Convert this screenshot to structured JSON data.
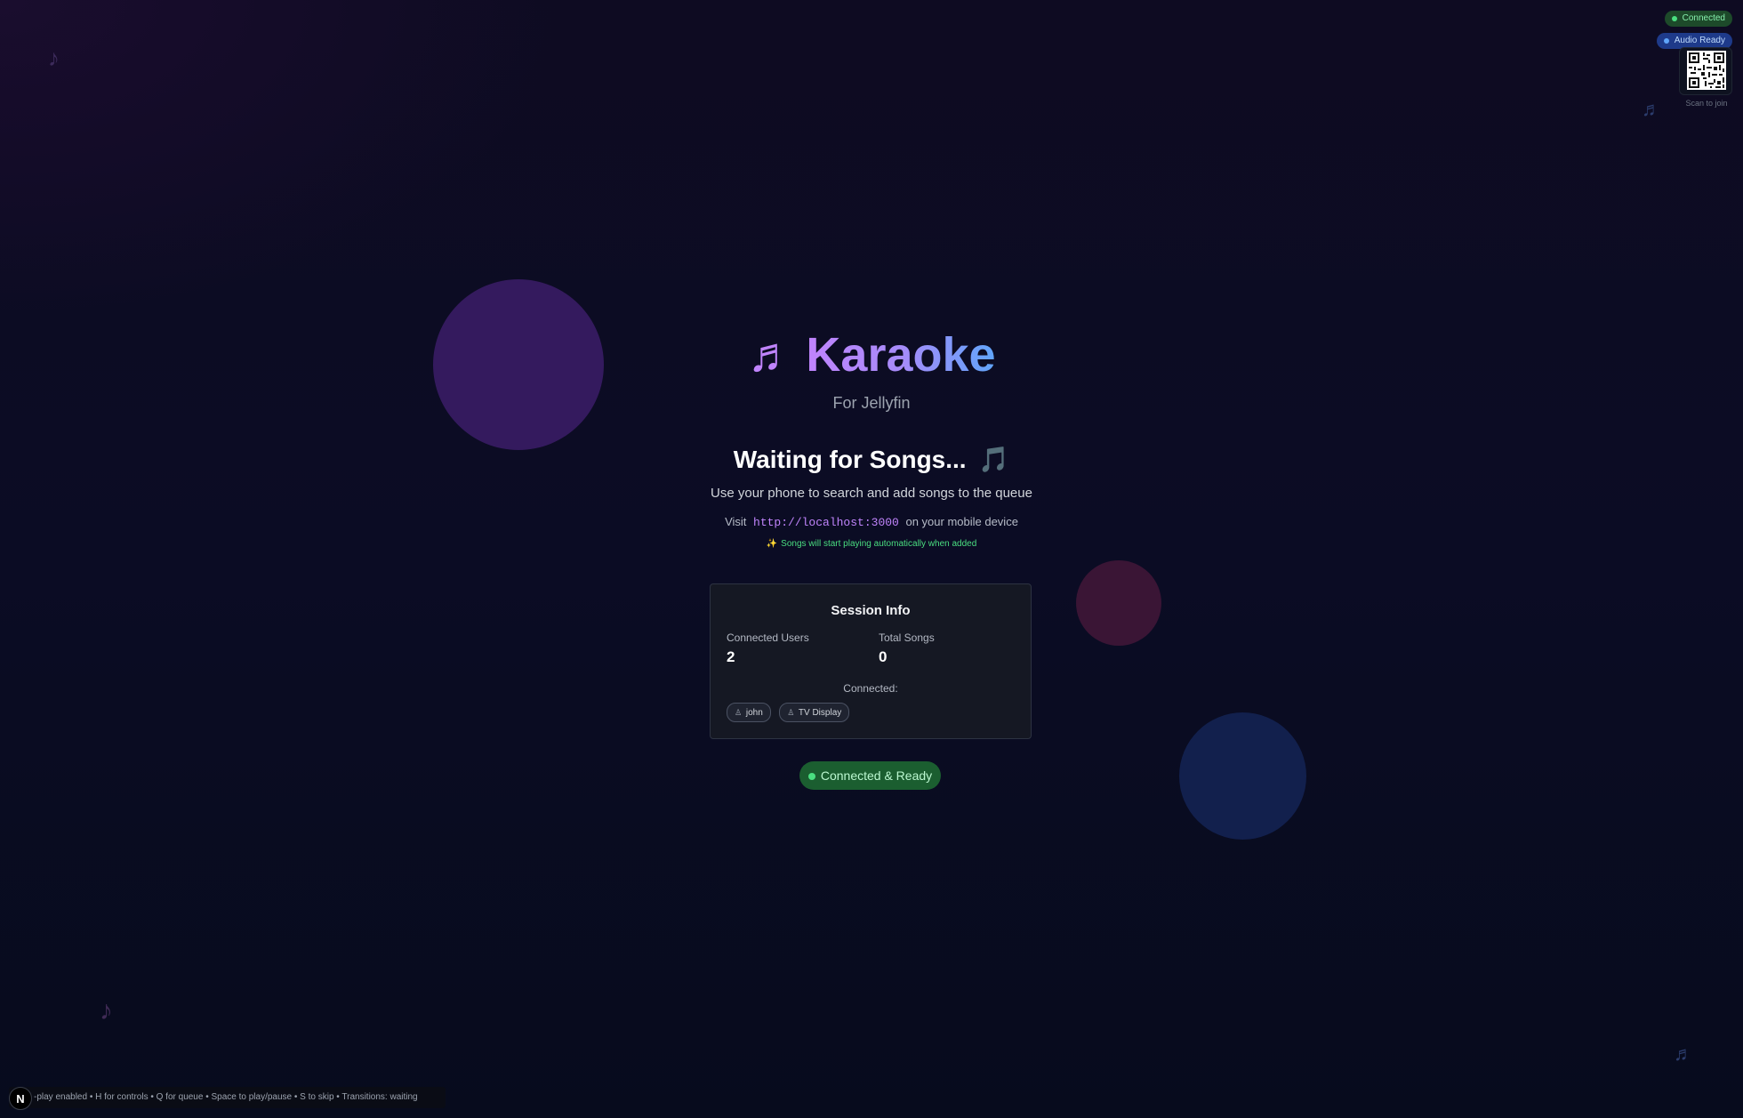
{
  "status": {
    "connection": "Connected",
    "audio": "Audio Ready",
    "qr_caption": "Scan to join"
  },
  "header": {
    "icon": "♬",
    "title": "Karaoke",
    "subtitle": "For Jellyfin"
  },
  "waiting": {
    "heading": "Waiting for Songs...",
    "heading_icon": "🎵",
    "instruction": "Use your phone to search and add songs to the queue",
    "visit_prefix": "Visit",
    "url": "http://localhost:3000",
    "visit_suffix": "on your mobile device",
    "auto_icon": "✨",
    "auto_text": "Songs will start playing automatically when added"
  },
  "session": {
    "title": "Session Info",
    "users_label": "Connected Users",
    "users_value": "2",
    "songs_label": "Total Songs",
    "songs_value": "0",
    "connected_label": "Connected:",
    "users": [
      {
        "name": "john"
      },
      {
        "name": "TV Display"
      }
    ]
  },
  "ready_badge": "Connected & Ready",
  "help_bar": "-play enabled • H for controls • Q for queue • Space to play/pause • S to skip • Transitions: waiting",
  "logo_letter": "N",
  "decorative_notes": [
    "♪",
    "♬",
    "♪",
    "♬"
  ],
  "colors": {
    "accent_purple": "#c084fc",
    "accent_blue": "#60a5fa",
    "success_green": "#4ade80"
  }
}
